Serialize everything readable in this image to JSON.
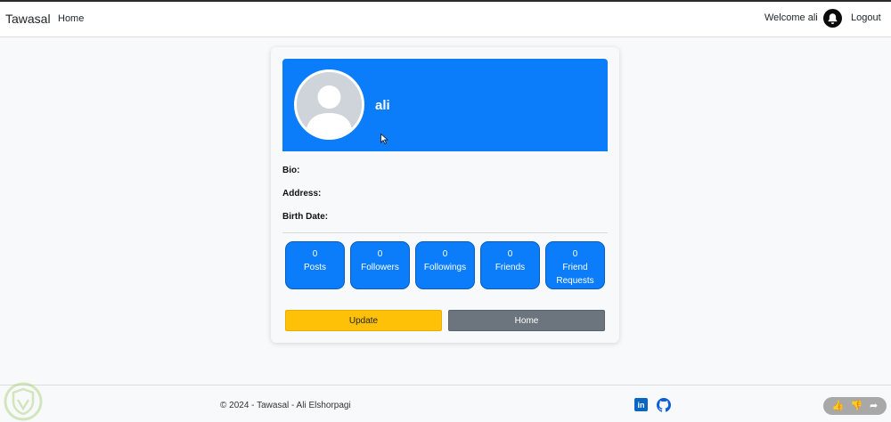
{
  "navbar": {
    "brand": "Tawasal",
    "home_link": "Home",
    "welcome": "Welcome ali",
    "notification_icon": "bell-icon",
    "logout": "Logout"
  },
  "profile": {
    "username": "ali",
    "avatar_icon": "user-avatar-icon",
    "bio_label": "Bio:",
    "address_label": "Address:",
    "birth_label": "Birth Date:",
    "banner_color": "#0b7dfa"
  },
  "stats": [
    {
      "count": "0",
      "label": "Posts"
    },
    {
      "count": "0",
      "label": "Followers"
    },
    {
      "count": "0",
      "label": "Followings"
    },
    {
      "count": "0",
      "label": "Friends"
    },
    {
      "count": "0",
      "label": "Friend Requests"
    }
  ],
  "buttons": {
    "update": "Update",
    "home": "Home"
  },
  "footer": {
    "copyright": "© 2024 - Tawasal - Ali Elshorpagi",
    "linkedin_icon": "linkedin-icon",
    "github_icon": "github-icon"
  },
  "colors": {
    "primary": "#0b7dfa",
    "warning": "#ffc107",
    "secondary": "#6c757d"
  }
}
